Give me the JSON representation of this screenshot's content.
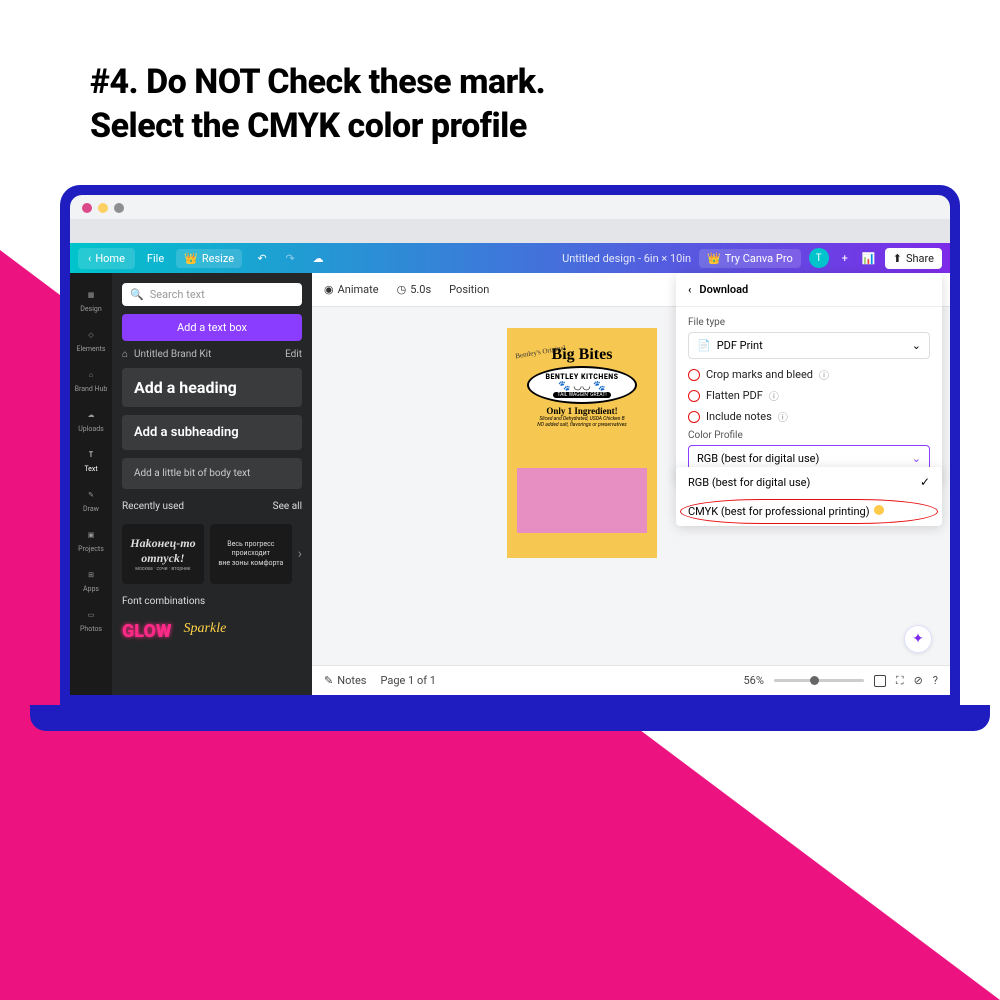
{
  "title_line1": "#4. Do NOT Check these mark.",
  "title_line2": "Select the CMYK color profile",
  "topbar": {
    "home": "Home",
    "file": "File",
    "resize": "Resize",
    "doc_title": "Untitled design - 6in × 10in",
    "try_pro": "Try Canva Pro",
    "user_initial": "T",
    "share": "Share"
  },
  "rail": {
    "design": "Design",
    "elements": "Elements",
    "brandhub": "Brand Hub",
    "uploads": "Uploads",
    "text": "Text",
    "draw": "Draw",
    "projects": "Projects",
    "apps": "Apps",
    "photos": "Photos"
  },
  "side": {
    "search_ph": "Search text",
    "add_box": "Add a text box",
    "brand_kit": "Untitled Brand Kit",
    "edit": "Edit",
    "h1": "Add a heading",
    "h2": "Add a subheading",
    "body": "Add a little bit of body text",
    "recent_label": "Recently used",
    "see_all": "See all",
    "recent1a": "Hakoнeц-mo",
    "recent1b": "omnyck!",
    "recent1c": "москва · сочи · вторник",
    "recent2a": "Весь прогресс",
    "recent2b": "происходит",
    "recent2c": "вне зоны комфорта",
    "font_combo": "Font combinations",
    "glow": "GLOW",
    "sparkle": "Sparkle"
  },
  "ctx": {
    "animate": "Animate",
    "duration": "5.0s",
    "position": "Position"
  },
  "canvas": {
    "bent_orig": "Bentley's Original",
    "big_bites": "Big Bites",
    "kitchen": "BENTLEY KITCHENS",
    "tag": "TAIL WAGGIN' GREAT!",
    "ing": "Only 1 Ingredient!",
    "ing_sub1": "Sliced and Dehydrated, USDA Chicken B",
    "ing_sub2": "NO added salt, flavorings or preservatives"
  },
  "bottom": {
    "notes": "Notes",
    "page": "Page 1 of 1",
    "zoom": "56%"
  },
  "download": {
    "title": "Download",
    "file_type": "File type",
    "pdf_print": "PDF Print",
    "crop": "Crop marks and bleed",
    "flatten": "Flatten PDF",
    "notes": "Include notes",
    "color_profile": "Color Profile",
    "rgb": "RGB (best for digital use)",
    "rgb_opt": "RGB (best for digital use)",
    "cmyk_opt": "CMYK (best for professional printing)"
  }
}
